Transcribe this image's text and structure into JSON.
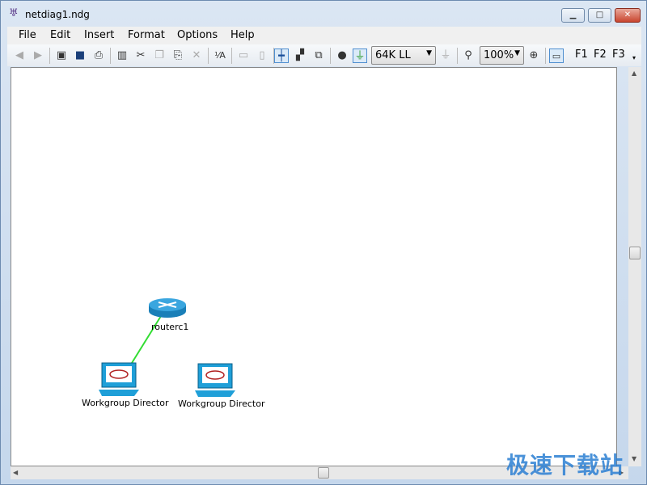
{
  "window": {
    "title": "netdiag1.ndg",
    "minimize": "▁",
    "maximize": "□",
    "close": "✕"
  },
  "menu": [
    "File",
    "Edit",
    "Insert",
    "Format",
    "Options",
    "Help"
  ],
  "toolbar": {
    "link_type": "64K LL",
    "zoom": "100%",
    "function_keys": [
      "F1",
      "F2",
      "F3"
    ]
  },
  "diagram": {
    "nodes": [
      {
        "type": "router",
        "label": "routerc1"
      },
      {
        "type": "workstation",
        "label": "Workgroup Director"
      },
      {
        "type": "workstation",
        "label": "Workgroup Director"
      }
    ],
    "links": [
      {
        "from": "routerc1",
        "to": "Workgroup Director",
        "color": "#33dd33"
      }
    ]
  },
  "watermark": "极速下载站"
}
